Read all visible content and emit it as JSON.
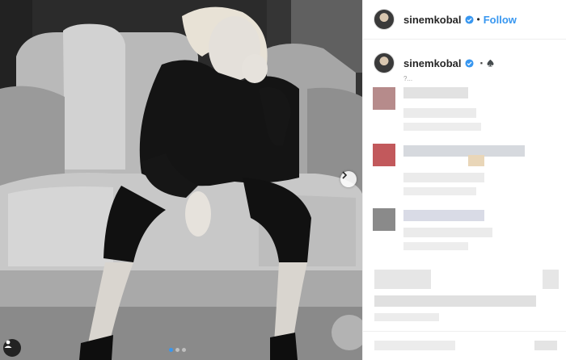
{
  "post": {
    "username": "sinemkobal",
    "follow_label": "Follow",
    "separator": "•",
    "caption_emoji": "▪️♠️",
    "caption_time": "?..."
  },
  "carousel": {
    "dots": 3,
    "active_index": 0
  },
  "colors": {
    "accent": "#3897f0",
    "verified": "#3897f0"
  },
  "icons": {
    "next": "chevron-right-icon",
    "tag": "person-tag-icon",
    "verified": "verified-badge-icon"
  }
}
